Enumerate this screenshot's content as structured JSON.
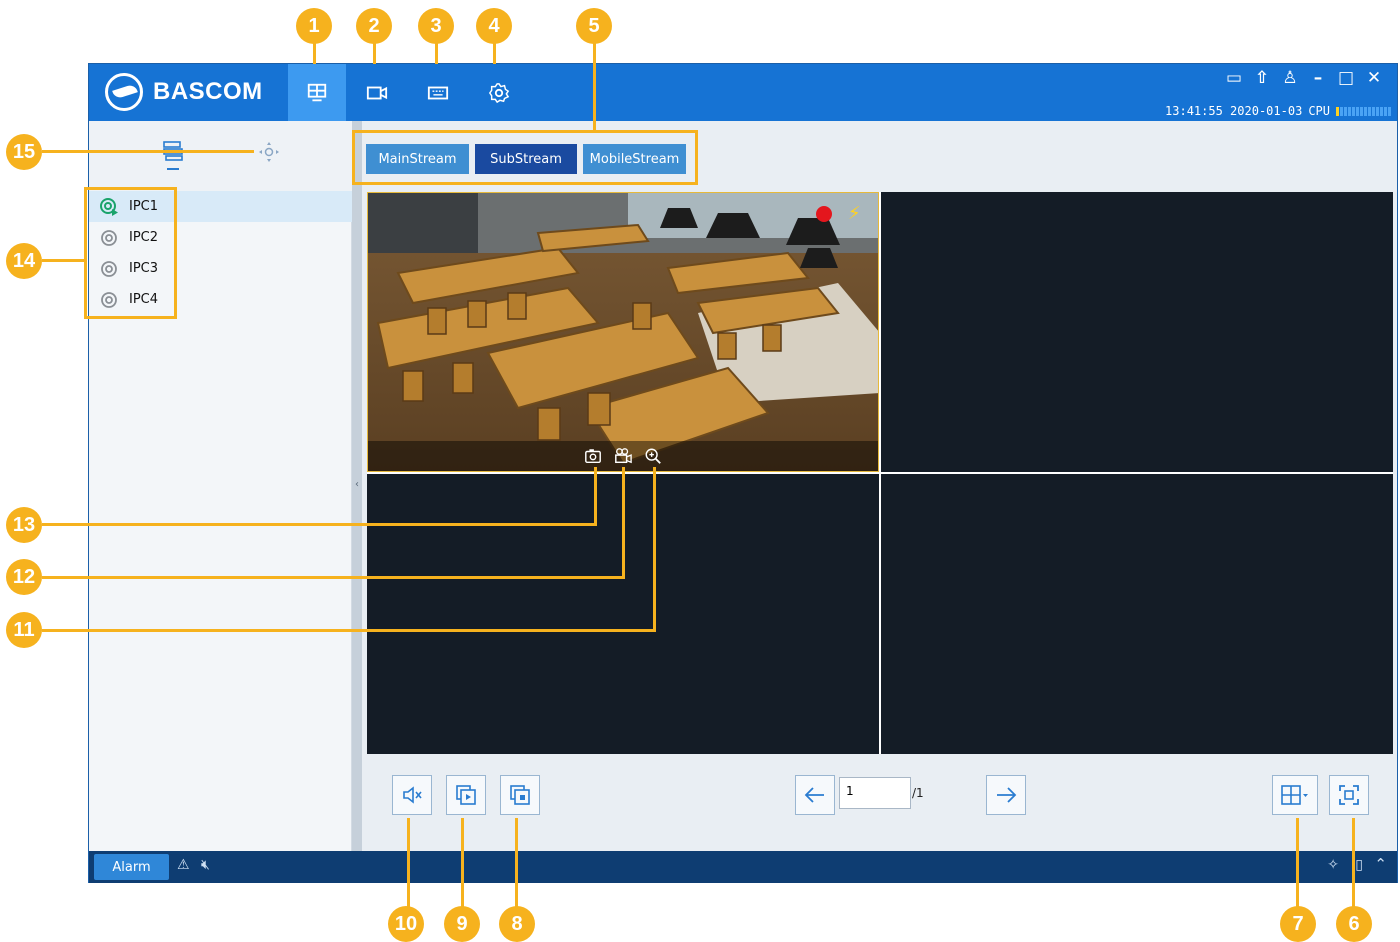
{
  "app": {
    "brand": "BASCOM",
    "time": "13:41:55 2020-01-03",
    "cpu_label": "CPU",
    "nav": [
      {
        "name": "live-view",
        "icon": "grid-icon",
        "active": true
      },
      {
        "name": "playback",
        "icon": "video-camera-icon",
        "active": false
      },
      {
        "name": "remote-device",
        "icon": "keyboard-icon",
        "active": false
      },
      {
        "name": "settings",
        "icon": "gear-icon",
        "active": false
      }
    ],
    "window_controls": [
      "screen-icon",
      "upload-icon",
      "user-icon",
      "minimize-icon",
      "maximize-icon",
      "close-icon"
    ]
  },
  "sidebar": {
    "tabs": [
      "device-list-icon",
      "ptz-icon"
    ],
    "devices": [
      {
        "label": "IPC1",
        "status": "playing"
      },
      {
        "label": "IPC2",
        "status": "idle"
      },
      {
        "label": "IPC3",
        "status": "idle"
      },
      {
        "label": "IPC4",
        "status": "idle"
      }
    ]
  },
  "streams": [
    {
      "label": "MainStream",
      "active": false
    },
    {
      "label": "SubStream",
      "active": true
    },
    {
      "label": "MobileStream",
      "active": false
    }
  ],
  "live": {
    "cell1_osd": [
      "snapshot-icon",
      "record-icon",
      "zoom-icon"
    ],
    "indicators": [
      "record-dot-icon",
      "motion-icon"
    ]
  },
  "toolbar": {
    "page_current": "1",
    "page_total": "/1"
  },
  "statusbar": {
    "alarm_label": "Alarm"
  },
  "annotations": [
    "1",
    "2",
    "3",
    "4",
    "5",
    "6",
    "7",
    "8",
    "9",
    "10",
    "11",
    "12",
    "13",
    "14",
    "15"
  ],
  "colors": {
    "header": "#1673d4",
    "nav_active": "#3d9af0",
    "stream_btn": "#3f8fd2",
    "stream_btn_active": "#1a4aa0",
    "statusbar": "#0e3d72",
    "annotation": "#f6b21e"
  }
}
